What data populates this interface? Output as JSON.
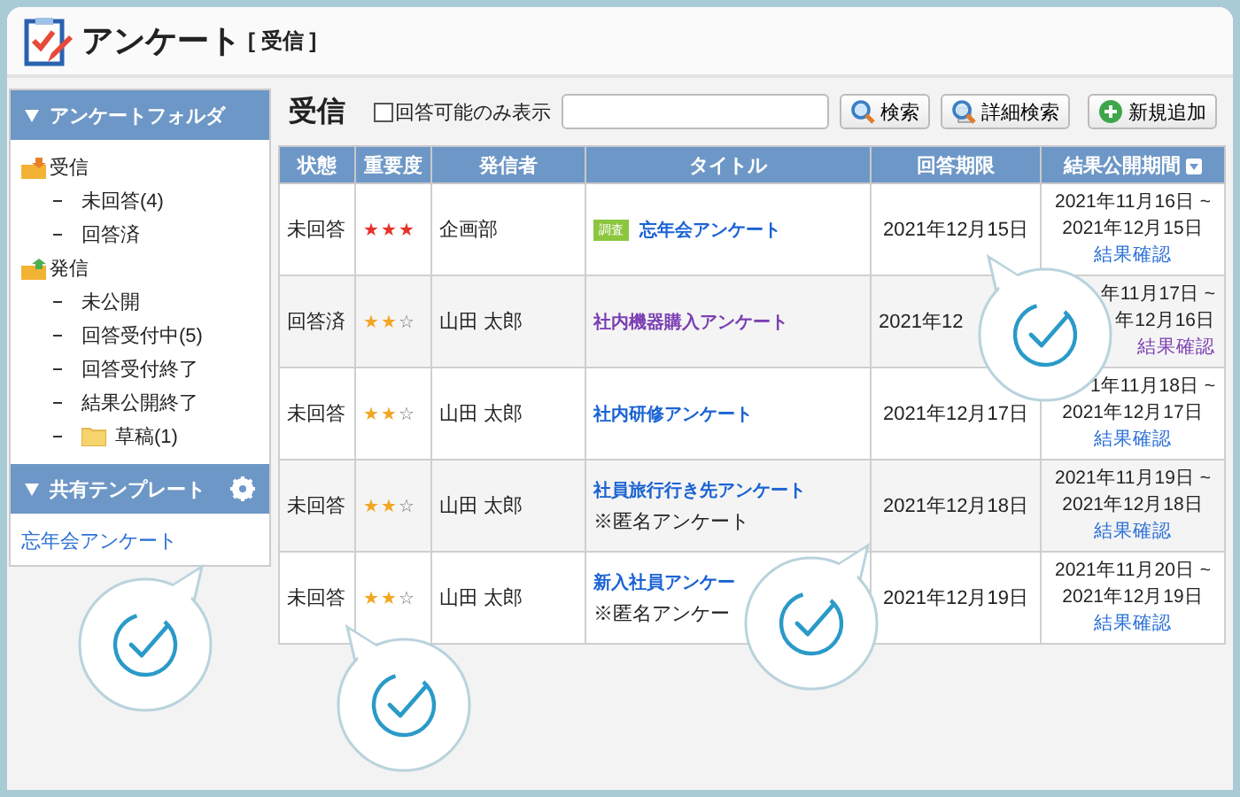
{
  "app": {
    "title": "アンケート",
    "subtitle": "[ 受信 ]"
  },
  "sidebar": {
    "folder_header": "アンケートフォルダ",
    "tree": [
      {
        "label": "受信",
        "kind": "received",
        "children": [
          {
            "label": "未回答(4)",
            "kind": "plain"
          },
          {
            "label": "回答済",
            "kind": "plain"
          }
        ]
      },
      {
        "label": "発信",
        "kind": "sent",
        "children": [
          {
            "label": "未公開",
            "kind": "plain"
          },
          {
            "label": "回答受付中(5)",
            "kind": "plain"
          },
          {
            "label": "回答受付終了",
            "kind": "plain"
          },
          {
            "label": "結果公開終了",
            "kind": "plain"
          },
          {
            "label": "草稿(1)",
            "kind": "folder"
          }
        ]
      }
    ],
    "template_header": "共有テンプレート",
    "templates": [
      "忘年会アンケート"
    ]
  },
  "main": {
    "heading": "受信",
    "filter": {
      "label": "回答可能のみ表示",
      "checked": false
    },
    "buttons": [
      {
        "label": "検索",
        "kind": "search"
      },
      {
        "label": "詳細検索",
        "kind": "advanced"
      },
      {
        "label": "新規追加",
        "kind": "add"
      }
    ]
  },
  "table": {
    "columns": [
      "状態",
      "重要度",
      "発信者",
      "タイトル",
      "回答期限",
      "結果公開期間"
    ],
    "rows": [
      {
        "status": "未回答",
        "stars": 3,
        "sender": "企画部",
        "tag": "調査",
        "title": "忘年会アンケート",
        "visited": false,
        "deadline": "2021年12月15日",
        "period": [
          "2021年11月16日 ~",
          "2021年12月15日"
        ],
        "result": "結果確認"
      },
      {
        "status": "回答済",
        "stars": 2,
        "sender": "山田 太郎",
        "title": "社内機器購入アンケート",
        "visited": true,
        "deadline": "2021年12",
        "period": [
          "年11月17日 ~",
          "年12月16日"
        ],
        "result": "結果確認"
      },
      {
        "status": "未回答",
        "stars": 2,
        "sender": "山田 太郎",
        "title": "社内研修アンケート",
        "visited": false,
        "deadline": "2021年12月17日",
        "period": [
          "1年11月18日 ~",
          "2021年12月17日"
        ],
        "result": "結果確認"
      },
      {
        "status": "未回答",
        "stars": 2,
        "sender": "山田 太郎",
        "title": "社員旅行行き先アンケート",
        "note": "※匿名アンケート",
        "visited": false,
        "deadline": "2021年12月18日",
        "period": [
          "2021年11月19日 ~",
          "2021年12月18日"
        ],
        "result": "結果確認"
      },
      {
        "status": "未回答",
        "stars": 2,
        "sender": "山田 太郎",
        "title": "新入社員アンケー",
        "note": "※匿名アンケー",
        "visited": false,
        "deadline": "2021年12月19日",
        "period": [
          "2021年11月20日 ~",
          "2021年12月19日"
        ],
        "result": "結果確認"
      }
    ]
  }
}
